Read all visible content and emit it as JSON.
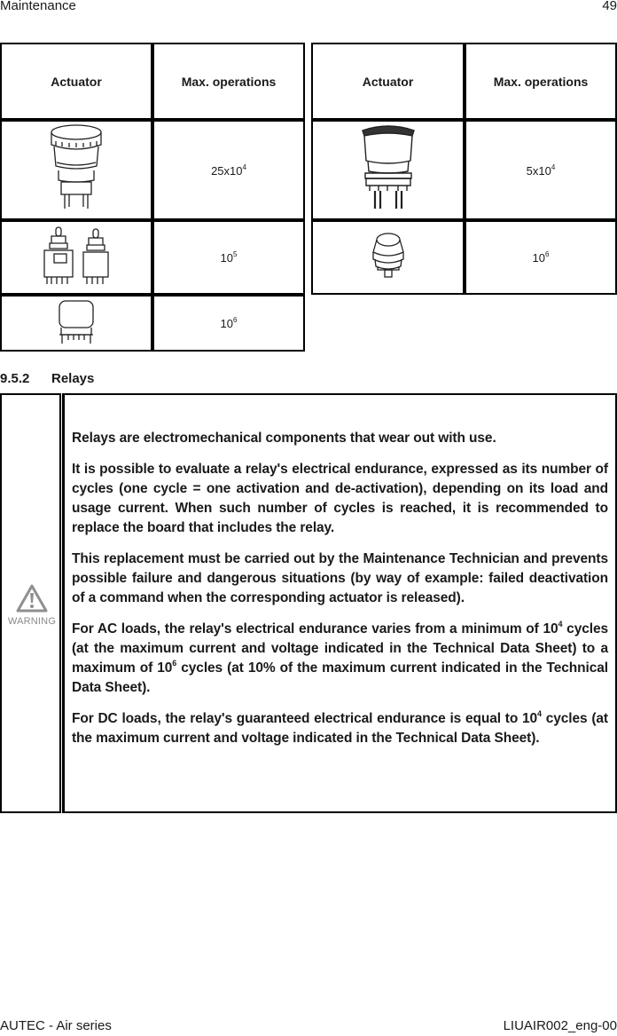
{
  "header": {
    "section": "Maintenance",
    "page_number": "49"
  },
  "footer": {
    "left": "AUTEC - Air series",
    "right": "LIUAIR002_eng-00"
  },
  "actuator_tables": {
    "left": {
      "headers": [
        "Actuator",
        "Max. operations"
      ],
      "rows": [
        {
          "actuator_icon": "mushroom-emergency-button",
          "base": "25x10",
          "exp": "4"
        },
        {
          "actuator_icon": "toggle-switches",
          "base": "10",
          "exp": "5"
        },
        {
          "actuator_icon": "square-push-button",
          "base": "10",
          "exp": "6"
        }
      ]
    },
    "right": {
      "headers": [
        "Actuator",
        "Max. operations"
      ],
      "rows": [
        {
          "actuator_icon": "large-mushroom-button",
          "base": "5x10",
          "exp": "4"
        },
        {
          "actuator_icon": "round-push-button",
          "base": "10",
          "exp": "6"
        }
      ]
    }
  },
  "section": {
    "number": "9.5.2",
    "title": "Relays"
  },
  "warning": {
    "icon_label": "WARNING",
    "paragraphs": {
      "p1": "Relays are electromechanical components that wear out with use.",
      "p2": "It is possible to evaluate a relay's electrical endurance, expressed as its number of cycles (one cycle = one activation and de-activation), depending on its load and usage current. When such number of cycles is reached, it is recommended to replace the board that includes the relay.",
      "p3": "This replacement must be carried out by the Maintenance Technician and prevents possible failure and dangerous situations (by way of example: failed deactivation of a command when the corresponding actuator is released).",
      "p4_a": "For AC loads, the relay's electrical endurance varies from a minimum of 10",
      "p4_exp1": "4",
      "p4_b": " cycles (at the maximum current and voltage indicated in the Technical Data Sheet) to a maximum of 10",
      "p4_exp2": "6",
      "p4_c": " cycles (at 10% of the maximum current indicated in the Technical Data Sheet).",
      "p5_a": "For DC loads, the relay's guaranteed electrical endurance is equal to 10",
      "p5_exp": "4",
      "p5_b": " cycles (at the maximum current and voltage indicated in the Technical Data Sheet)."
    }
  }
}
